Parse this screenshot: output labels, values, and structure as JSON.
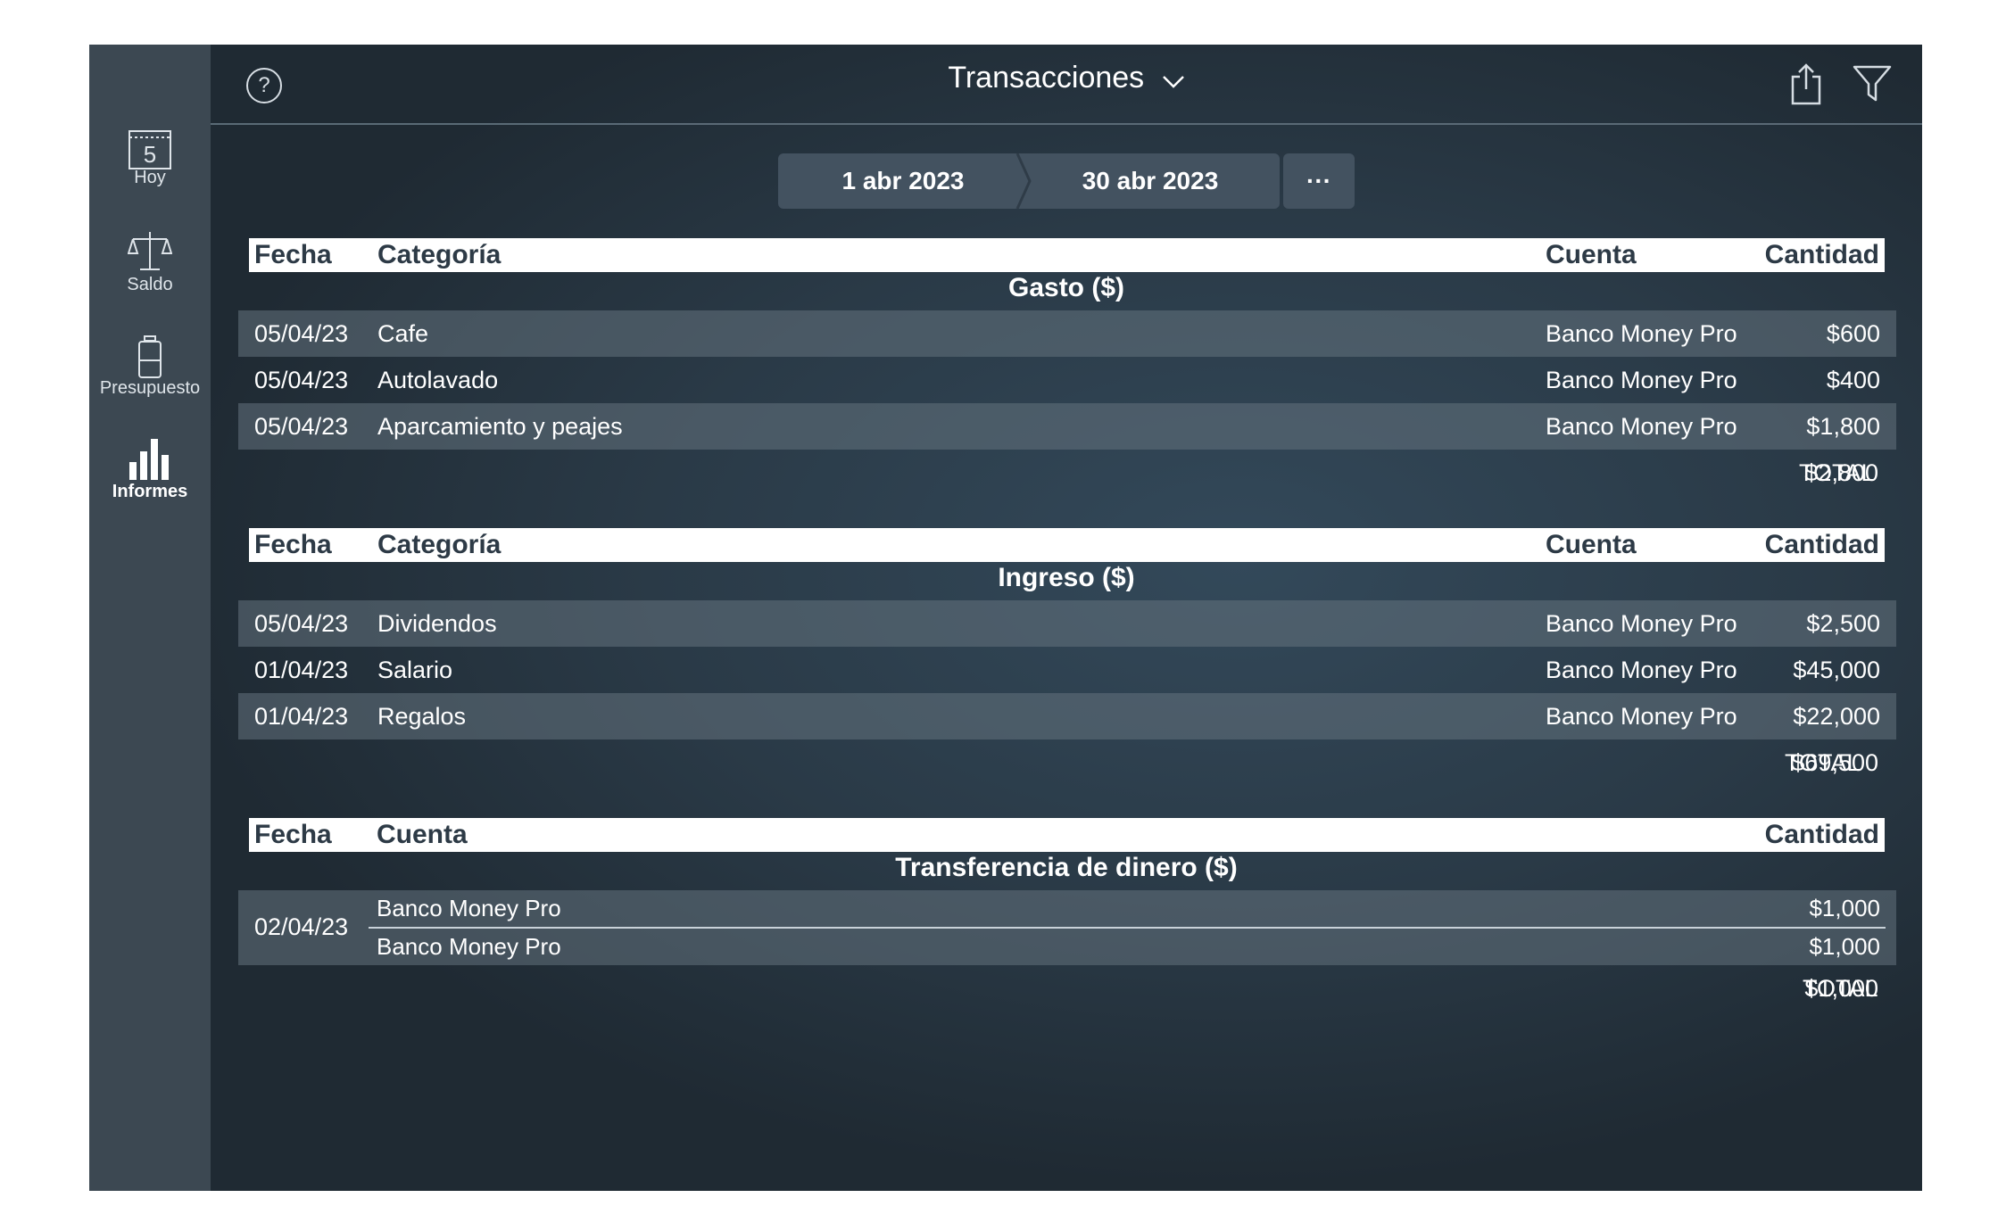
{
  "sidebar": {
    "items": [
      {
        "label": "Hoy",
        "icon": "calendar-icon",
        "day": "5"
      },
      {
        "label": "Saldo",
        "icon": "scale-icon"
      },
      {
        "label": "Presupuesto",
        "icon": "budget-jar-icon"
      },
      {
        "label": "Informes",
        "icon": "bar-chart-icon"
      }
    ]
  },
  "header": {
    "title": "Transacciones",
    "help_symbol": "?",
    "icons": [
      "help-icon",
      "chevron-down-icon",
      "share-icon",
      "filter-icon"
    ]
  },
  "date_range": {
    "start": "1 abr 2023",
    "end": "30 abr 2023",
    "more": "···"
  },
  "expense": {
    "columns": {
      "date": "Fecha",
      "category": "Categoría",
      "account": "Cuenta",
      "amount": "Cantidad"
    },
    "title": "Gasto ($)",
    "rows": [
      {
        "date": "05/04/23",
        "category": "Cafe",
        "account": "Banco Money Pro",
        "amount": "$600"
      },
      {
        "date": "05/04/23",
        "category": "Autolavado",
        "account": "Banco Money Pro",
        "amount": "$400"
      },
      {
        "date": "05/04/23",
        "category": "Aparcamiento y peajes",
        "account": "Banco Money Pro",
        "amount": "$1,800"
      }
    ],
    "total_label": "TOTAL",
    "total": "$2,800"
  },
  "income": {
    "columns": {
      "date": "Fecha",
      "category": "Categoría",
      "account": "Cuenta",
      "amount": "Cantidad"
    },
    "title": "Ingreso ($)",
    "rows": [
      {
        "date": "05/04/23",
        "category": "Dividendos",
        "account": "Banco Money Pro",
        "amount": "$2,500"
      },
      {
        "date": "01/04/23",
        "category": "Salario",
        "account": "Banco Money Pro",
        "amount": "$45,000"
      },
      {
        "date": "01/04/23",
        "category": "Regalos",
        "account": "Banco Money Pro",
        "amount": "$22,000"
      }
    ],
    "total_label": "TOTAL",
    "total": "$69,500"
  },
  "transfer": {
    "columns": {
      "date": "Fecha",
      "account": "Cuenta",
      "amount": "Cantidad"
    },
    "title": "Transferencia de dinero ($)",
    "rows": [
      {
        "date": "02/04/23",
        "from_account": "Banco Money Pro",
        "from_amount": "$1,000",
        "to_account": "Banco Money Pro",
        "to_amount": "$1,000"
      }
    ],
    "total_label": "TOTAL",
    "total": "$1,000"
  }
}
